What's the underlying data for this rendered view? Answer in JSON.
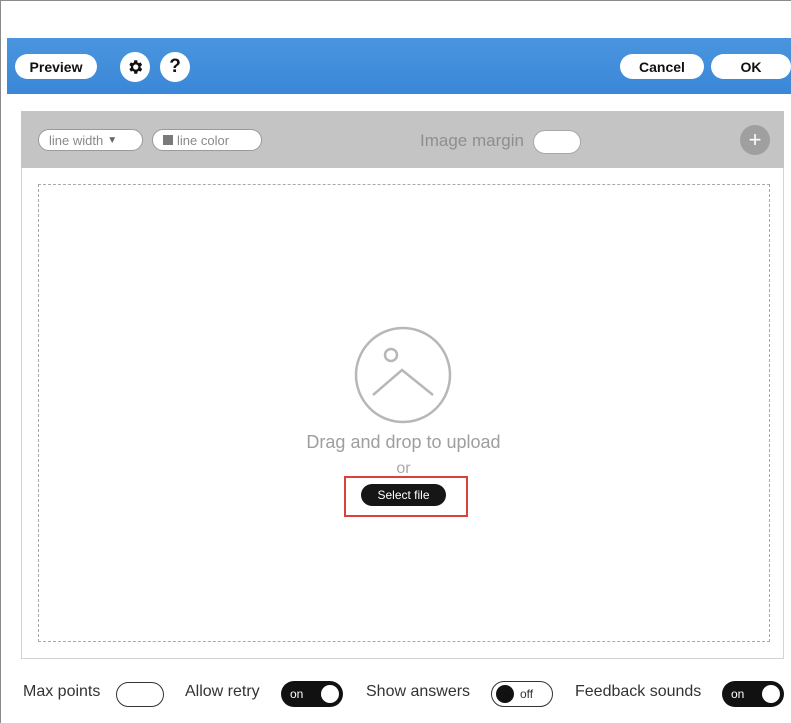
{
  "header": {
    "preview_label": "Preview",
    "gear_icon": "gear-icon",
    "help_label": "?",
    "cancel_label": "Cancel",
    "ok_label": "OK",
    "bar_color": "#3a87d8"
  },
  "toolbar": {
    "line_width_label": "line width",
    "line_width_arrow": "▼",
    "line_color_label": "line color",
    "image_margin_label": "Image margin",
    "add_label": "+"
  },
  "dropzone": {
    "placeholder_icon": "image-icon",
    "drag_text": "Drag and drop to upload",
    "or_text": "or",
    "select_file_label": "Select file",
    "highlight_color": "#d9423b"
  },
  "settings": {
    "max_points_label": "Max points",
    "allow_retry_label": "Allow retry",
    "allow_retry_state": "on",
    "show_answers_label": "Show answers",
    "show_answers_state": "off",
    "feedback_sounds_label": "Feedback sounds",
    "feedback_sounds_state": "on"
  }
}
